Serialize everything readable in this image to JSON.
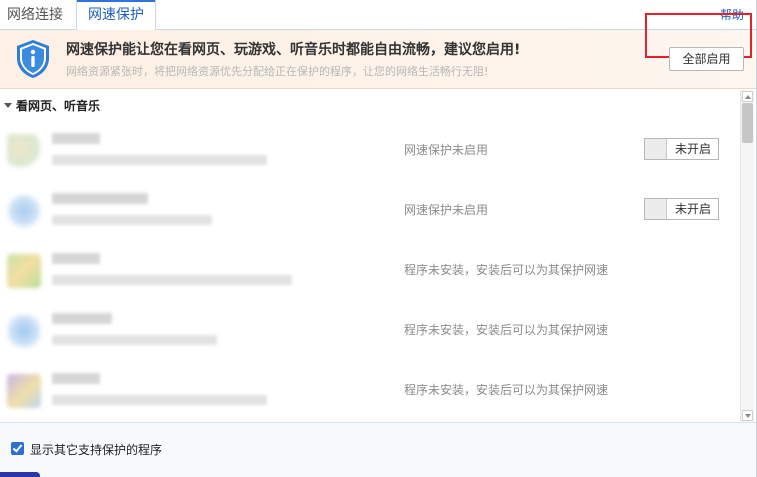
{
  "tabs": {
    "network_connection": "网络连接",
    "speed_protection": "网速保护",
    "help": "帮助"
  },
  "banner": {
    "title": "网速保护能让您在看网页、玩游戏、听音乐时都能自由流畅，建议您启用!",
    "subtitle": "网络资源紧张时，将把网络资源优先分配给正在保护的程序，让您的网络生活畅行无阻!",
    "enable_all_label": "全部启用",
    "icon": "shield-info-icon",
    "accent_color": "#e2212a"
  },
  "section": {
    "title": "看网页、听音乐"
  },
  "rows": [
    {
      "status": "网速保护未启用",
      "toggle_label": "未开启",
      "has_toggle": true
    },
    {
      "status": "网速保护未启用",
      "toggle_label": "未开启",
      "has_toggle": true
    },
    {
      "status": "程序未安装，安装后可以为其保护网速",
      "has_toggle": false
    },
    {
      "status": "程序未安装，安装后可以为其保护网速",
      "has_toggle": false
    },
    {
      "status": "程序未安装，安装后可以为其保护网速",
      "has_toggle": false
    }
  ],
  "footer": {
    "show_other_label": "显示其它支持保护的程序",
    "show_other_checked": true
  }
}
